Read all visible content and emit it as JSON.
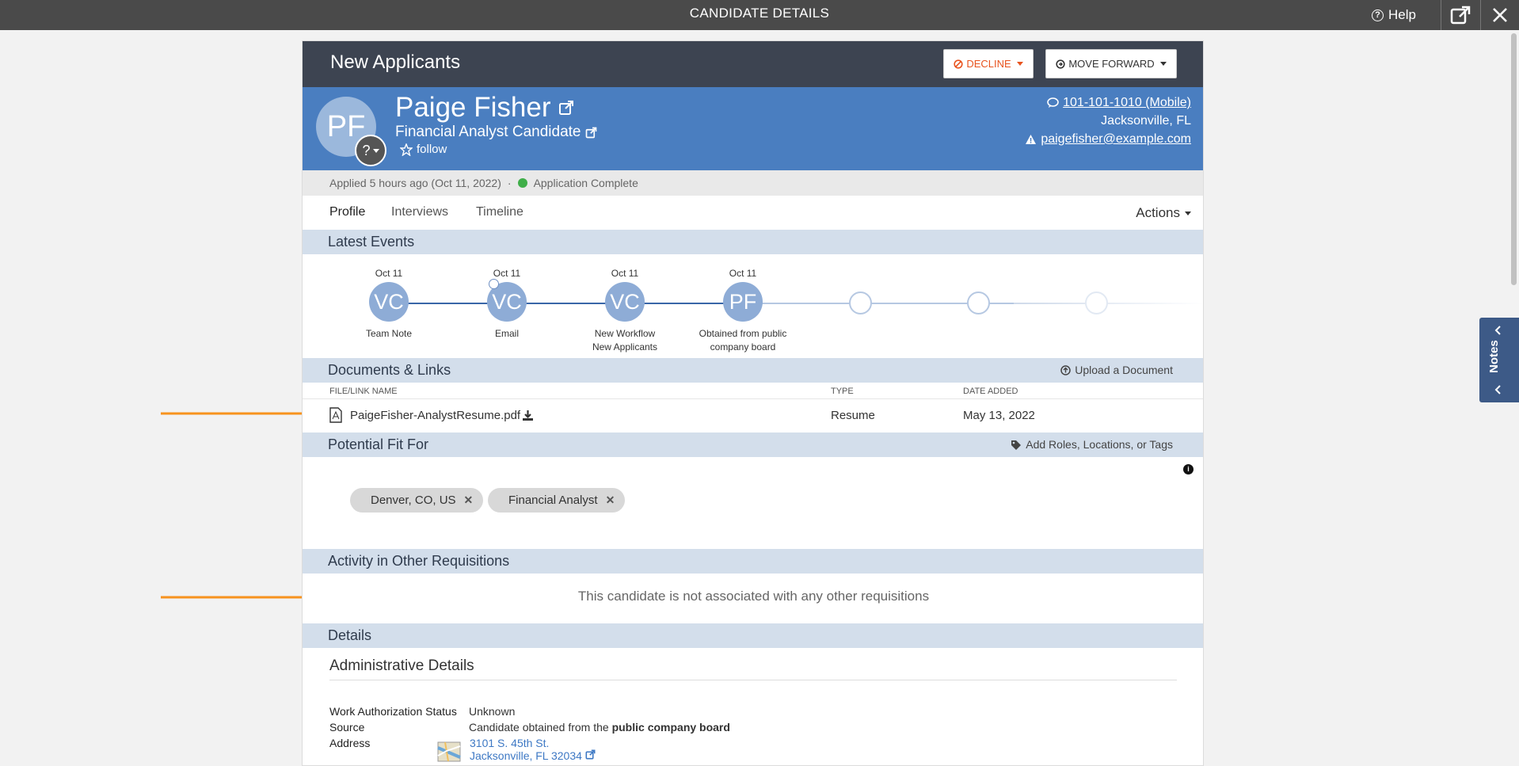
{
  "window": {
    "title": "CANDIDATE DETAILS",
    "help_label": "Help"
  },
  "stage": {
    "title": "New Applicants",
    "decline_label": "DECLINE",
    "forward_label": "MOVE FORWARD"
  },
  "candidate": {
    "initials": "PF",
    "badge_label": "?",
    "name": "Paige Fisher",
    "title": "Financial Analyst Candidate",
    "follow_label": "follow",
    "phone": "101-101-1010 (Mobile)",
    "location": "Jacksonville, FL",
    "email": "paigefisher@example.com"
  },
  "status": {
    "applied": "Applied 5 hours ago (Oct 11, 2022)",
    "separator": "·",
    "state": "Application Complete",
    "state_color": "#3fae49"
  },
  "tabs": [
    {
      "label": "Profile"
    },
    {
      "label": "Interviews"
    },
    {
      "label": "Timeline"
    }
  ],
  "actions_label": "Actions",
  "latest_events": {
    "title": "Latest Events",
    "events": [
      {
        "date": "Oct 11",
        "initials": "VC",
        "label": "Team Note",
        "label2": ""
      },
      {
        "date": "Oct 11",
        "initials": "VC",
        "label": "Email",
        "label2": ""
      },
      {
        "date": "Oct 11",
        "initials": "VC",
        "label": "New Workflow",
        "label2": "New Applicants"
      },
      {
        "date": "Oct 11",
        "initials": "PF",
        "label": "Obtained from public",
        "label2": "company board"
      }
    ]
  },
  "documents": {
    "title": "Documents & Links",
    "upload_label": "Upload a Document",
    "columns": {
      "name": "FILE/LINK NAME",
      "type": "TYPE",
      "date": "DATE ADDED"
    },
    "files": [
      {
        "name": "PaigeFisher-AnalystResume.pdf",
        "type": "Resume",
        "date": "May 13, 2022"
      }
    ]
  },
  "potential_fit": {
    "title": "Potential Fit For",
    "add_label": "Add Roles, Locations, or Tags",
    "tags": [
      "Denver, CO, US",
      "Financial Analyst"
    ]
  },
  "other_reqs": {
    "title": "Activity in Other Requisitions",
    "empty_message": "This candidate is not associated with any other requisitions"
  },
  "details": {
    "title": "Details",
    "admin_title": "Administrative Details",
    "work_auth_label": "Work Authorization Status",
    "work_auth_value": "Unknown",
    "source_label": "Source",
    "source_prefix": "Candidate obtained from the",
    "source_bold": "public company board",
    "address_label": "Address",
    "address_line1": "3101 S. 45th St.",
    "address_line2": "Jacksonville, FL 32034"
  },
  "notes_label": "Notes",
  "colors": {
    "accent_blue": "#4a7ec0",
    "header_dark": "#3d4451",
    "decline": "#e8531e",
    "arrow": "#f7931e"
  }
}
